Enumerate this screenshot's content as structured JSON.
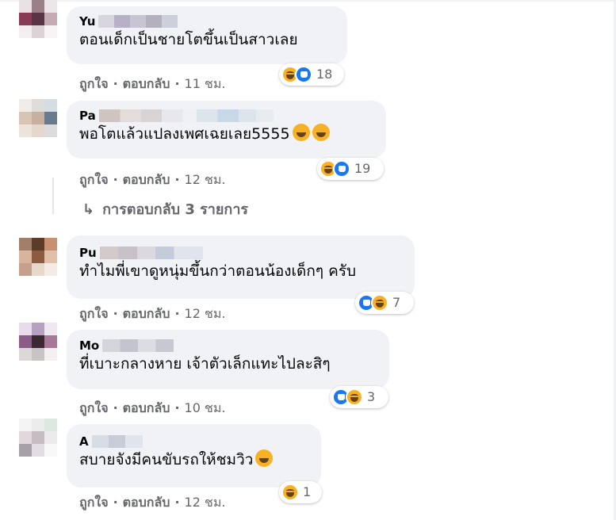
{
  "comments": [
    {
      "name": "Yu",
      "text": "ตอนเด็กเป็นชายโตขึ้นเป็นสาวเลย",
      "like": "ถูกใจ",
      "reply": "ตอบกลับ",
      "time": "11 ชม.",
      "reaction_count": "18"
    },
    {
      "name": "Pa",
      "text": "พอโตแล้วแปลงเพศเฉยเลย5555",
      "like": "ถูกใจ",
      "reply": "ตอบกลับ",
      "time": "12 ชม.",
      "reaction_count": "19"
    },
    {
      "name": "Pu",
      "text": "ทำไมพี่เขาดูหนุ่มขึ้นกว่าตอนน้องเด็กๆ ครับ",
      "like": "ถูกใจ",
      "reply": "ตอบกลับ",
      "time": "12 ชม.",
      "reaction_count": "7"
    },
    {
      "name": "Mo",
      "text": "ที่เบาะกลางหาย เจ้าตัวเล็กแทะไปละสิๆ",
      "like": "ถูกใจ",
      "reply": "ตอบกลับ",
      "time": "10 ชม.",
      "reaction_count": "3"
    },
    {
      "name": "A",
      "text": "สบายจังมีคนขับรถให้ชมวิว",
      "like": "ถูกใจ",
      "reply": "ตอบกลับ",
      "time": "12 ชม.",
      "reaction_count": "1"
    }
  ],
  "replies_link": {
    "label": "การตอบกลับ 3 รายการ"
  },
  "icons": {
    "like": "like-reaction-icon",
    "haha": "haha-reaction-icon",
    "reply_arrow": "reply-arrow-icon"
  },
  "colors": {
    "bubble": "#f0f2f5",
    "secondary_text": "#65676b",
    "like_blue": "#1877f2",
    "haha_yellow": "#f7b125"
  }
}
